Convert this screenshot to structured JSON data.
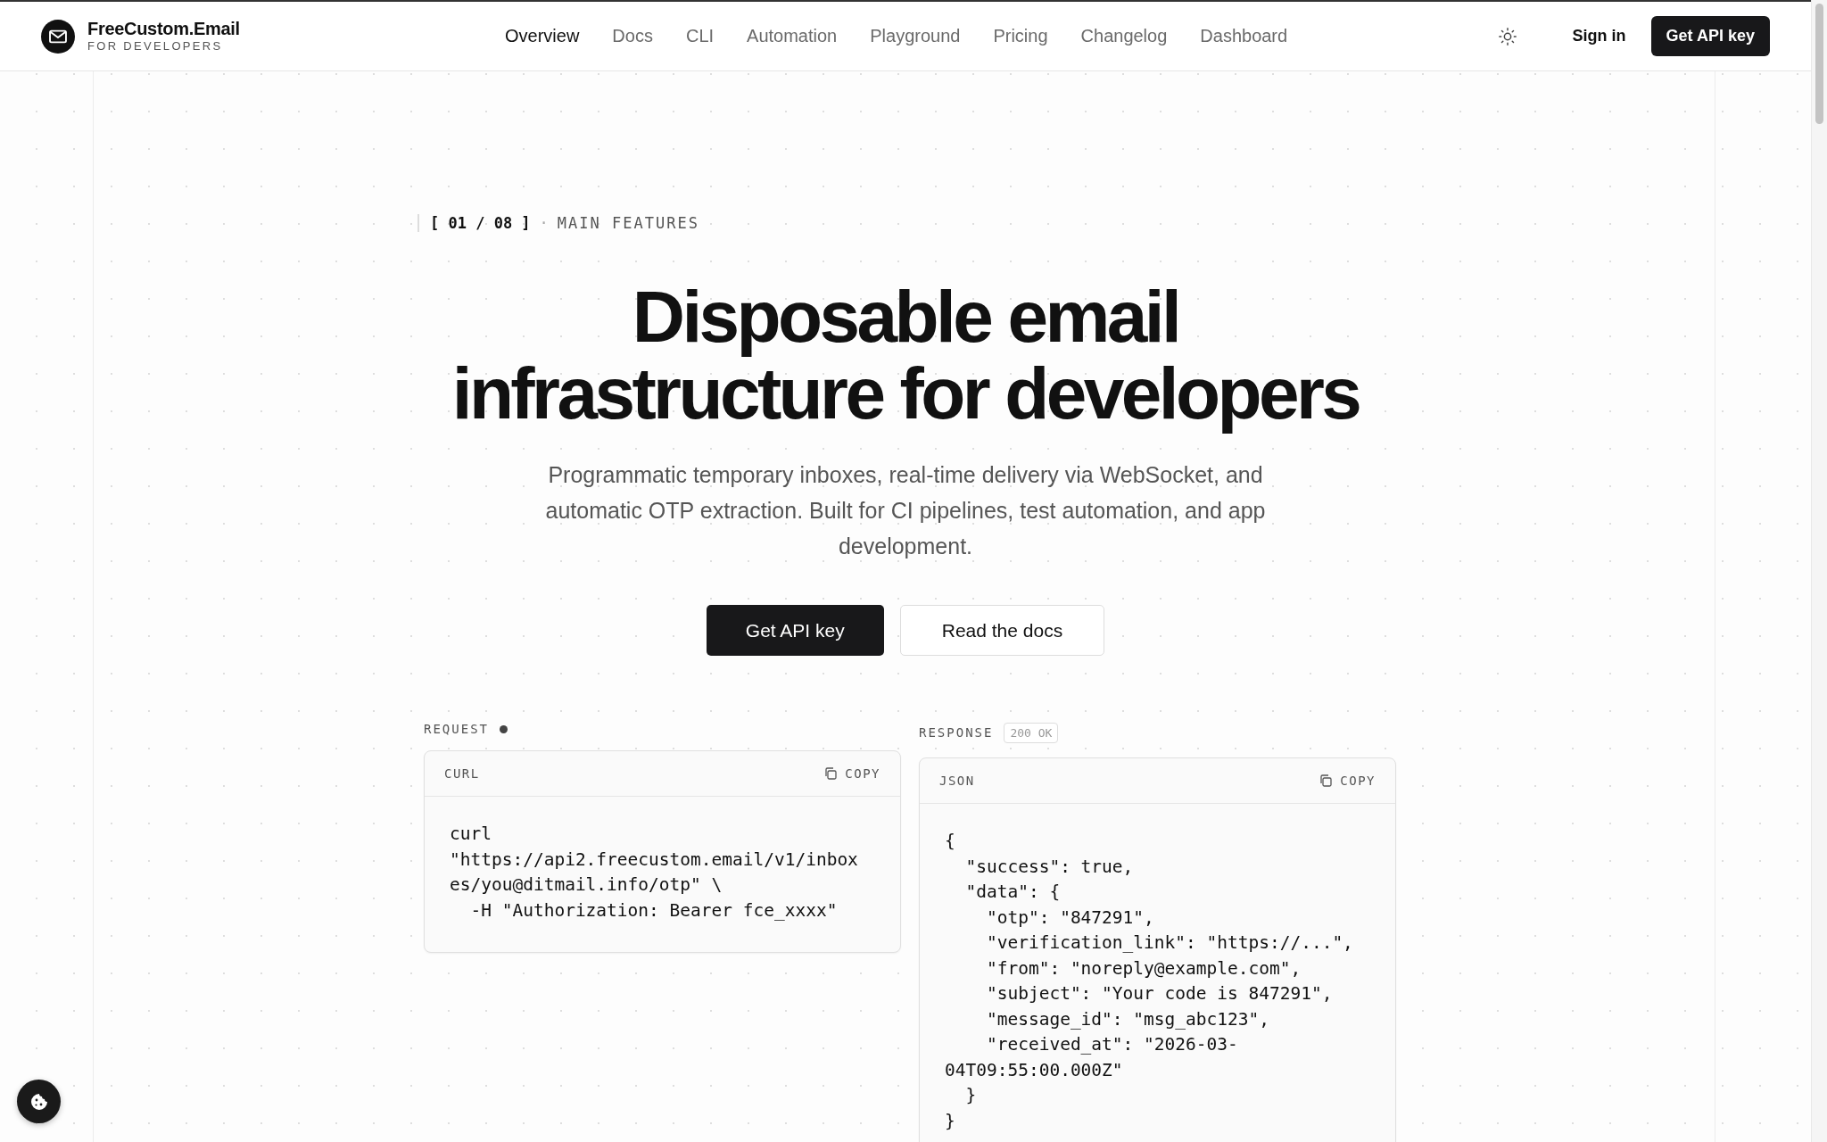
{
  "brand": {
    "name": "FreeCustom.Email",
    "tagline": "FOR DEVELOPERS"
  },
  "nav": [
    {
      "label": "Overview",
      "selected": true
    },
    {
      "label": "Docs",
      "selected": false
    },
    {
      "label": "CLI",
      "selected": false
    },
    {
      "label": "Automation",
      "selected": false
    },
    {
      "label": "Playground",
      "selected": false
    },
    {
      "label": "Pricing",
      "selected": false
    },
    {
      "label": "Changelog",
      "selected": false
    },
    {
      "label": "Dashboard",
      "selected": false
    }
  ],
  "header_actions": {
    "sign_in": "Sign in",
    "cta": "Get API key"
  },
  "eyebrow": {
    "counter": "[ 01 / 08 ]",
    "separator": "·",
    "label": "MAIN FEATURES"
  },
  "headline": [
    "Disposable email",
    "infrastructure for developers"
  ],
  "subtitle": "Programmatic temporary inboxes, real-time delivery via WebSocket, and automatic OTP extraction. Built for CI pipelines, test automation, and app development.",
  "buttons": [
    {
      "label": "Get API key",
      "kind": "primary"
    },
    {
      "label": "Read the docs",
      "kind": "secondary"
    }
  ],
  "request": {
    "label": "REQUEST",
    "panel": {
      "language": "CURL",
      "copy": "COPY",
      "lines": [
        "curl",
        "\"https://api2.freecustom.email/v1/inbox",
        "es/you@ditmail.info/otp\" \\",
        "  -H \"Authorization: Bearer fce_xxxx\""
      ]
    }
  },
  "response": {
    "label": "RESPONSE",
    "status": "200 OK",
    "panel": {
      "language": "JSON",
      "copy": "COPY",
      "lines": [
        "{",
        "  \"success\": true,",
        "  \"data\": {",
        "    \"otp\": \"847291\",",
        "    \"verification_link\": \"https://...\",",
        "    \"from\": \"noreply@example.com\",",
        "    \"subject\": \"Your code is 847291\",",
        "    \"message_id\": \"msg_abc123\",",
        "    \"received_at\": \"2026-03-",
        "04T09:55:00.000Z\"",
        "  }",
        "}"
      ]
    }
  }
}
